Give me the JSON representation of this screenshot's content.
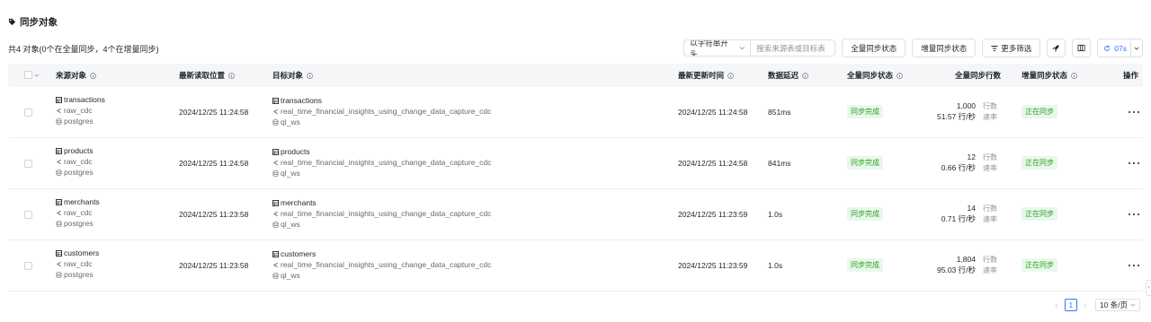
{
  "header": {
    "title": "同步对象"
  },
  "summary": "共4 对象(0个在全量同步，4个在增量同步)",
  "toolbar": {
    "search_mode": "以字符串开头",
    "search_placeholder": "搜索来源表或目标表",
    "full_sync_status_btn": "全量同步状态",
    "incr_sync_status_btn": "增量同步状态",
    "more_filter_btn": "更多筛选",
    "refresh_interval": "07s"
  },
  "columns": {
    "source": "来源对象",
    "last_read": "最新读取位置",
    "target": "目标对象",
    "last_update": "最新更新时间",
    "latency": "数据延迟",
    "full_status": "全量同步状态",
    "full_rows": "全量同步行数",
    "incr_status": "增量同步状态",
    "actions": "操作"
  },
  "units": {
    "rows": "行数",
    "rate": "速率"
  },
  "rows": [
    {
      "source": {
        "table": "transactions",
        "schema": "raw_cdc",
        "db": "postgres"
      },
      "last_read": "2024/12/25 11:24:58",
      "target": {
        "table": "transactions",
        "schema": "real_time_financial_insights_using_change_data_capture_cdc",
        "db": "ql_ws"
      },
      "last_update": "2024/12/25 11:24:58",
      "latency": "851ms",
      "full_status": "同步完成",
      "full_rows": "1,000",
      "rate": "51.57 行/秒",
      "incr_status": "正在同步"
    },
    {
      "source": {
        "table": "products",
        "schema": "raw_cdc",
        "db": "postgres"
      },
      "last_read": "2024/12/25 11:24:58",
      "target": {
        "table": "products",
        "schema": "real_time_financial_insights_using_change_data_capture_cdc",
        "db": "ql_ws"
      },
      "last_update": "2024/12/25 11:24:58",
      "latency": "841ms",
      "full_status": "同步完成",
      "full_rows": "12",
      "rate": "0.66 行/秒",
      "incr_status": "正在同步"
    },
    {
      "source": {
        "table": "merchants",
        "schema": "raw_cdc",
        "db": "postgres"
      },
      "last_read": "2024/12/25 11:23:58",
      "target": {
        "table": "merchants",
        "schema": "real_time_financial_insights_using_change_data_capture_cdc",
        "db": "ql_ws"
      },
      "last_update": "2024/12/25 11:23:59",
      "latency": "1.0s",
      "full_status": "同步完成",
      "full_rows": "14",
      "rate": "0.71 行/秒",
      "incr_status": "正在同步"
    },
    {
      "source": {
        "table": "customers",
        "schema": "raw_cdc",
        "db": "postgres"
      },
      "last_read": "2024/12/25 11:23:58",
      "target": {
        "table": "customers",
        "schema": "real_time_financial_insights_using_change_data_capture_cdc",
        "db": "ql_ws"
      },
      "last_update": "2024/12/25 11:23:59",
      "latency": "1.0s",
      "full_status": "同步完成",
      "full_rows": "1,804",
      "rate": "95.03 行/秒",
      "incr_status": "正在同步"
    }
  ],
  "pagination": {
    "current_page": "1",
    "page_size": "10 条/页"
  },
  "colors": {
    "accent": "#3370ff",
    "success_text": "#2ea121",
    "success_bg": "#e8f8ec",
    "header_bg": "#f5f6f7"
  },
  "icons": [
    "tag-icon",
    "info-icon",
    "table-icon",
    "schema-icon",
    "database-icon",
    "chevron-down-icon",
    "filter-icon",
    "rocket-icon",
    "columns-icon",
    "refresh-icon",
    "more-icon",
    "chevron-left-icon",
    "chevron-right-icon",
    "collapse-handle-icon"
  ]
}
